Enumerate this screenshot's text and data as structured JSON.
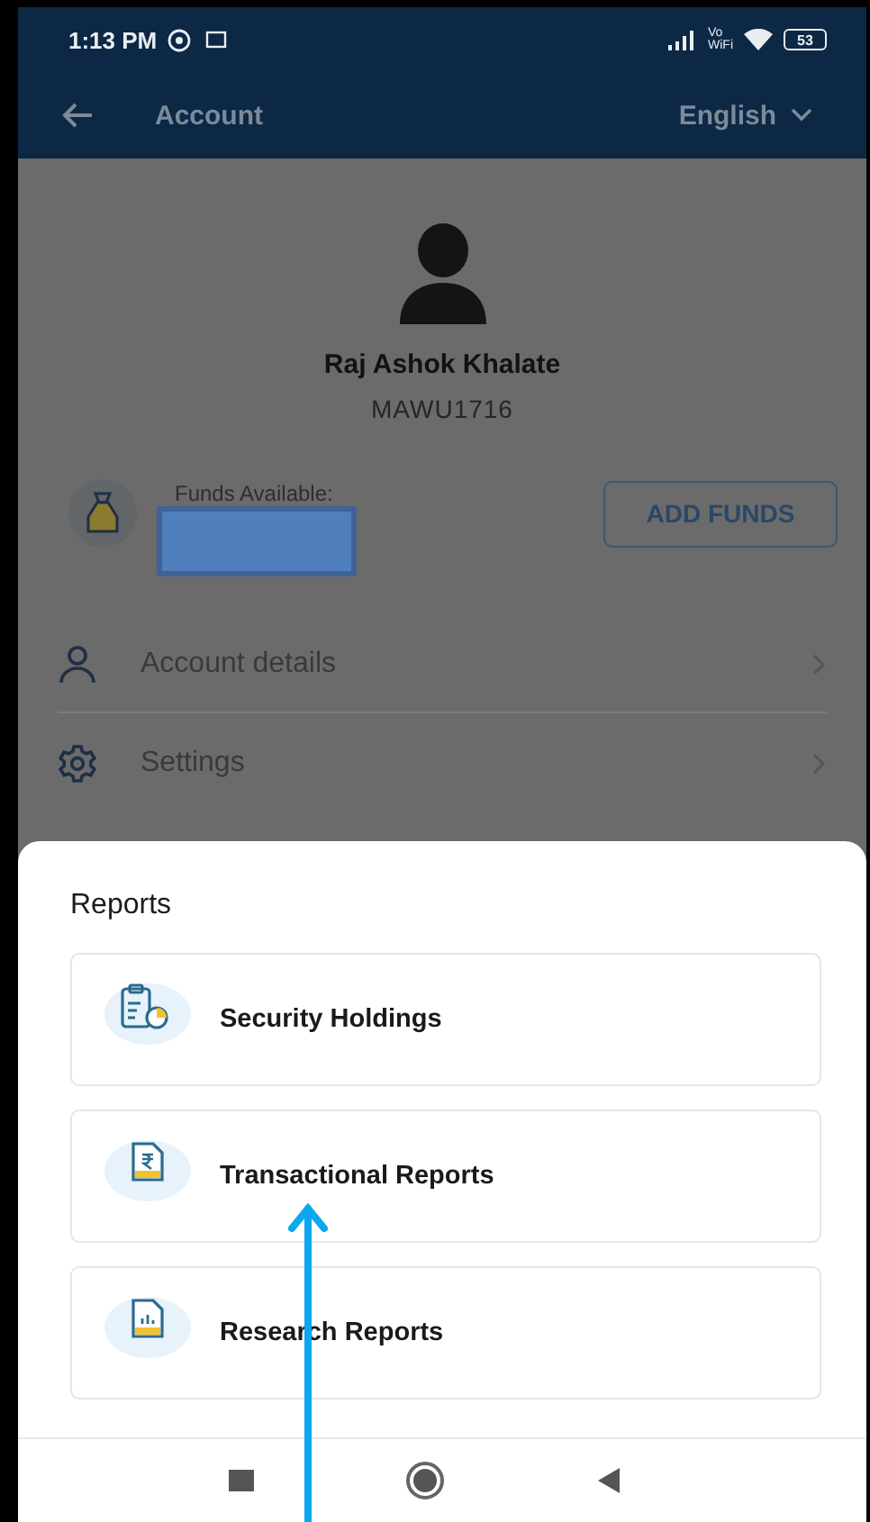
{
  "status_bar": {
    "time": "1:13 PM",
    "network_label_top": "Vo",
    "network_label_bottom": "WiFi",
    "battery": "53"
  },
  "header": {
    "title": "Account",
    "language": "English"
  },
  "profile": {
    "name": "Raj Ashok Khalate",
    "client_id": "MAWU1716"
  },
  "funds": {
    "label": "Funds Available:",
    "button": "ADD FUNDS"
  },
  "menu": [
    {
      "kind": "person",
      "label": "Account details"
    },
    {
      "kind": "gear",
      "label": "Settings"
    }
  ],
  "reports": {
    "title": "Reports",
    "items": [
      {
        "kind": "holdings",
        "label": "Security Holdings"
      },
      {
        "kind": "transaction",
        "label": "Transactional Reports"
      },
      {
        "kind": "research",
        "label": "Research Reports"
      }
    ]
  }
}
